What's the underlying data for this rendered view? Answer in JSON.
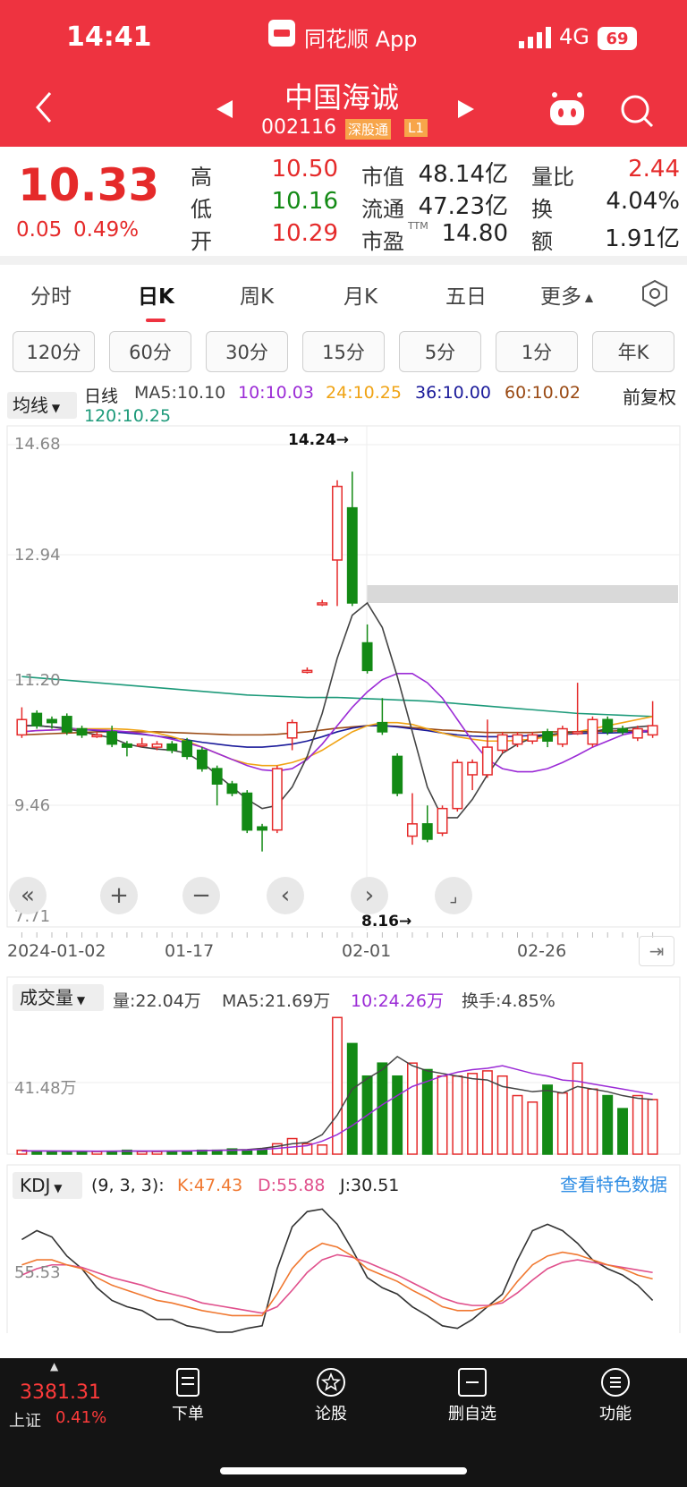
{
  "status": {
    "time": "14:41",
    "center_app": "同花顺 App",
    "signal": "4G",
    "battery": "69"
  },
  "stock": {
    "name": "中国海诚",
    "code": "002116",
    "tag1": "深股通",
    "tag2": "L1"
  },
  "quote": {
    "price": "10.33",
    "change": "0.05",
    "change_pct": "0.49%",
    "high_label": "高",
    "high": "10.50",
    "low_label": "低",
    "low": "10.16",
    "open_label": "开",
    "open": "10.29",
    "mcap_label": "市值",
    "mcap": "48.14亿",
    "float_label": "流通",
    "float": "47.23亿",
    "pe_label": "市盈",
    "pe_sup": "TTM",
    "pe": "14.80",
    "vr_label": "量比",
    "vr": "2.44",
    "turn_label": "换",
    "turn": "4.04%",
    "amt_label": "额",
    "amt": "1.91亿"
  },
  "tabs": [
    "分时",
    "日K",
    "周K",
    "月K",
    "五日",
    "更多"
  ],
  "periods": [
    "120分",
    "60分",
    "30分",
    "15分",
    "5分",
    "1分",
    "年K"
  ],
  "kline": {
    "ma_select": "均线",
    "kind": "日线",
    "ma5": "MA5:10.10",
    "ma10": "10:10.03",
    "ma24": "24:10.25",
    "ma36": "36:10.00",
    "ma60": "60:10.02",
    "ma120": "120:10.25",
    "adjust": "前复权",
    "ticks": [
      "14.68",
      "12.94",
      "11.20",
      "9.46",
      "7.71"
    ],
    "max_note": "14.24→",
    "min_note": "8.16→",
    "dates": [
      "2024-01-02",
      "01-17",
      "02-01",
      "02-26"
    ]
  },
  "volume": {
    "select": "成交量",
    "vol": "量:22.04万",
    "ma5": "MA5:21.69万",
    "ma10": "10:24.26万",
    "turnover": "换手:4.85%",
    "tick": "41.48万"
  },
  "kdj": {
    "select": "KDJ",
    "params": "(9, 3, 3):",
    "k": "K:47.43",
    "d": "D:55.88",
    "j": "J:30.51",
    "tick": "55.53",
    "feature_link": "查看特色数据"
  },
  "bottom": {
    "index_value": "3381.31",
    "index_name": "上证",
    "index_pct": "0.41%",
    "nav": [
      "下单",
      "论股",
      "删自选",
      "功能"
    ]
  },
  "chart_data": {
    "type": "candlestick",
    "title": "",
    "xlabel": "",
    "ylabel": "",
    "ylim": [
      7.71,
      14.68
    ],
    "bars": [
      {
        "o": 9.95,
        "c": 10.2,
        "h": 10.4,
        "l": 9.9
      },
      {
        "o": 10.3,
        "c": 10.1,
        "h": 10.35,
        "l": 10.05
      },
      {
        "o": 10.2,
        "c": 10.15,
        "h": 10.25,
        "l": 10.05
      },
      {
        "o": 10.25,
        "c": 10.0,
        "h": 10.3,
        "l": 9.95
      },
      {
        "o": 10.05,
        "c": 9.95,
        "h": 10.1,
        "l": 9.9
      },
      {
        "o": 9.95,
        "c": 9.95,
        "h": 10.0,
        "l": 9.9
      },
      {
        "o": 10.0,
        "c": 9.8,
        "h": 10.1,
        "l": 9.75
      },
      {
        "o": 9.8,
        "c": 9.75,
        "h": 9.85,
        "l": 9.6
      },
      {
        "o": 9.8,
        "c": 9.8,
        "h": 9.9,
        "l": 9.75
      },
      {
        "o": 9.75,
        "c": 9.8,
        "h": 9.85,
        "l": 9.7
      },
      {
        "o": 9.8,
        "c": 9.7,
        "h": 9.85,
        "l": 9.65
      },
      {
        "o": 9.85,
        "c": 9.6,
        "h": 9.9,
        "l": 9.55
      },
      {
        "o": 9.7,
        "c": 9.4,
        "h": 9.75,
        "l": 9.35
      },
      {
        "o": 9.4,
        "c": 9.15,
        "h": 9.45,
        "l": 8.8
      },
      {
        "o": 9.15,
        "c": 9.0,
        "h": 9.2,
        "l": 8.95
      },
      {
        "o": 9.0,
        "c": 8.4,
        "h": 9.05,
        "l": 8.35
      },
      {
        "o": 8.45,
        "c": 8.4,
        "h": 8.5,
        "l": 8.05
      },
      {
        "o": 8.4,
        "c": 9.4,
        "h": 9.45,
        "l": 8.35
      },
      {
        "o": 9.9,
        "c": 10.15,
        "h": 10.2,
        "l": 9.7
      },
      {
        "o": 11.0,
        "c": 11.0,
        "h": 11.05,
        "l": 10.95
      },
      {
        "o": 12.1,
        "c": 12.1,
        "h": 12.15,
        "l": 12.05
      },
      {
        "o": 12.8,
        "c": 14.0,
        "h": 14.1,
        "l": 12.05
      },
      {
        "o": 13.65,
        "c": 12.1,
        "h": 14.24,
        "l": 12.05
      },
      {
        "o": 11.45,
        "c": 11.0,
        "h": 11.75,
        "l": 10.95
      },
      {
        "o": 10.15,
        "c": 10.0,
        "h": 10.55,
        "l": 9.95
      },
      {
        "o": 9.6,
        "c": 9.0,
        "h": 9.65,
        "l": 8.95
      },
      {
        "o": 8.3,
        "c": 8.5,
        "h": 9.0,
        "l": 8.16
      },
      {
        "o": 8.5,
        "c": 8.25,
        "h": 8.8,
        "l": 8.2
      },
      {
        "o": 8.35,
        "c": 8.75,
        "h": 8.8,
        "l": 8.3
      },
      {
        "o": 8.75,
        "c": 9.5,
        "h": 9.55,
        "l": 8.7
      },
      {
        "o": 9.3,
        "c": 9.5,
        "h": 9.55,
        "l": 9.05
      },
      {
        "o": 9.3,
        "c": 9.75,
        "h": 10.2,
        "l": 9.25
      },
      {
        "o": 9.7,
        "c": 9.95,
        "h": 10.0,
        "l": 9.65
      },
      {
        "o": 9.8,
        "c": 9.95,
        "h": 10.0,
        "l": 9.75
      },
      {
        "o": 9.85,
        "c": 9.95,
        "h": 10.0,
        "l": 9.8
      },
      {
        "o": 10.0,
        "c": 9.85,
        "h": 10.05,
        "l": 9.75
      },
      {
        "o": 9.8,
        "c": 10.05,
        "h": 10.1,
        "l": 9.75
      },
      {
        "o": 10.0,
        "c": 10.0,
        "h": 10.8,
        "l": 9.95
      },
      {
        "o": 9.8,
        "c": 10.2,
        "h": 10.25,
        "l": 9.75
      },
      {
        "o": 10.2,
        "c": 10.0,
        "h": 10.25,
        "l": 9.95
      },
      {
        "o": 10.05,
        "c": 10.0,
        "h": 10.1,
        "l": 9.95
      },
      {
        "o": 9.9,
        "c": 10.05,
        "h": 10.1,
        "l": 9.85
      },
      {
        "o": 9.95,
        "c": 10.1,
        "h": 10.5,
        "l": 9.9
      }
    ],
    "ma5": [
      10.1,
      10.1,
      10.08,
      10.05,
      10.0,
      9.95,
      9.9,
      9.8,
      9.75,
      9.72,
      9.7,
      9.65,
      9.5,
      9.3,
      9.1,
      8.9,
      8.75,
      8.8,
      9.1,
      9.6,
      10.3,
      11.2,
      11.9,
      12.1,
      11.7,
      10.9,
      10.0,
      9.1,
      8.6,
      8.6,
      8.9,
      9.3,
      9.65,
      9.8,
      9.9,
      9.95,
      9.98,
      10.0,
      10.0,
      10.05,
      10.05,
      10.08,
      10.1
    ],
    "ma10": [
      10.0,
      10.02,
      10.03,
      10.04,
      10.04,
      10.03,
      10.02,
      10.0,
      9.97,
      9.93,
      9.88,
      9.82,
      9.75,
      9.65,
      9.55,
      9.45,
      9.38,
      9.36,
      9.4,
      9.55,
      9.8,
      10.1,
      10.4,
      10.65,
      10.85,
      10.95,
      10.95,
      10.8,
      10.55,
      10.2,
      9.85,
      9.55,
      9.4,
      9.35,
      9.35,
      9.4,
      9.5,
      9.62,
      9.75,
      9.85,
      9.95,
      10.0,
      10.03
    ],
    "ma24": [
      10.0,
      10.02,
      10.03,
      10.04,
      10.05,
      10.05,
      10.05,
      10.04,
      10.02,
      9.98,
      9.92,
      9.85,
      9.75,
      9.65,
      9.55,
      9.48,
      9.45,
      9.45,
      9.5,
      9.58,
      9.7,
      9.85,
      10.0,
      10.1,
      10.15,
      10.15,
      10.12,
      10.05,
      9.98,
      9.92,
      9.88,
      9.85,
      9.85,
      9.86,
      9.88,
      9.92,
      9.96,
      10.0,
      10.05,
      10.1,
      10.15,
      10.2,
      10.25
    ],
    "ma36": [
      10.1,
      10.1,
      10.08,
      10.06,
      10.04,
      10.02,
      10.0,
      9.98,
      9.96,
      9.93,
      9.9,
      9.87,
      9.83,
      9.8,
      9.77,
      9.75,
      9.75,
      9.77,
      9.8,
      9.85,
      9.92,
      10.0,
      10.06,
      10.1,
      10.1,
      10.08,
      10.05,
      10.02,
      9.98,
      9.95,
      9.93,
      9.92,
      9.92,
      9.93,
      9.94,
      9.95,
      9.96,
      9.97,
      9.98,
      9.98,
      9.99,
      10.0,
      10.0
    ],
    "ma60": [
      9.95,
      9.96,
      9.97,
      9.98,
      9.99,
      10.0,
      10.0,
      10.0,
      10.0,
      10.0,
      9.99,
      9.98,
      9.97,
      9.96,
      9.95,
      9.95,
      9.95,
      9.96,
      9.98,
      10.0,
      10.03,
      10.06,
      10.08,
      10.1,
      10.1,
      10.09,
      10.07,
      10.05,
      10.03,
      10.02,
      10.0,
      9.99,
      9.99,
      9.99,
      9.99,
      10.0,
      10.0,
      10.0,
      10.01,
      10.01,
      10.02,
      10.02,
      10.02
    ],
    "ma120": [
      10.9,
      10.88,
      10.86,
      10.84,
      10.82,
      10.8,
      10.78,
      10.76,
      10.74,
      10.72,
      10.7,
      10.68,
      10.66,
      10.64,
      10.62,
      10.6,
      10.59,
      10.58,
      10.57,
      10.56,
      10.56,
      10.56,
      10.55,
      10.54,
      10.53,
      10.52,
      10.51,
      10.5,
      10.48,
      10.46,
      10.44,
      10.42,
      10.4,
      10.38,
      10.36,
      10.34,
      10.32,
      10.3,
      10.29,
      10.28,
      10.27,
      10.26,
      10.25
    ],
    "volume": [
      3,
      2,
      2,
      2,
      2,
      2,
      2,
      3,
      2,
      2,
      2,
      2,
      3,
      3,
      4,
      3,
      4,
      8,
      12,
      8,
      7,
      105,
      85,
      60,
      70,
      60,
      70,
      65,
      60,
      60,
      62,
      64,
      60,
      45,
      40,
      53,
      47,
      70,
      50,
      45,
      35,
      45,
      42
    ],
    "vol_ma5": [
      2.5,
      2.5,
      2.4,
      2.3,
      2.2,
      2.2,
      2.3,
      2.4,
      2.3,
      2.3,
      2.4,
      2.5,
      2.8,
      3.0,
      3.3,
      3.5,
      4.5,
      6.0,
      8.0,
      9.0,
      15,
      30,
      50,
      58,
      65,
      75,
      68,
      64,
      62,
      60,
      58,
      57,
      52,
      50,
      48,
      49,
      47,
      52,
      50,
      48,
      45,
      43,
      42
    ],
    "vol_ma10": [
      2.5,
      2.5,
      2.4,
      2.4,
      2.4,
      2.3,
      2.3,
      2.4,
      2.4,
      2.4,
      2.4,
      2.5,
      2.7,
      2.9,
      3.0,
      3.2,
      3.6,
      4.5,
      5.5,
      6.5,
      10,
      15,
      22,
      30,
      38,
      45,
      52,
      56,
      60,
      63,
      65,
      66,
      68,
      65,
      62,
      60,
      57,
      56,
      54,
      52,
      50,
      48,
      46
    ],
    "kdj_k": [
      58,
      62,
      62,
      58,
      55,
      48,
      42,
      38,
      34,
      30,
      28,
      25,
      22,
      20,
      18,
      18,
      18,
      35,
      55,
      68,
      75,
      72,
      65,
      55,
      50,
      45,
      38,
      32,
      25,
      22,
      22,
      25,
      30,
      45,
      58,
      65,
      68,
      66,
      62,
      58,
      55,
      50,
      47
    ],
    "kdj_d": [
      50,
      55,
      58,
      58,
      56,
      52,
      48,
      45,
      42,
      38,
      35,
      32,
      28,
      26,
      24,
      22,
      20,
      25,
      38,
      52,
      62,
      66,
      64,
      60,
      55,
      50,
      44,
      38,
      32,
      28,
      26,
      26,
      28,
      36,
      46,
      55,
      60,
      62,
      60,
      58,
      56,
      54,
      52
    ],
    "kdj_j": [
      78,
      85,
      80,
      65,
      55,
      40,
      30,
      25,
      22,
      15,
      15,
      10,
      8,
      5,
      5,
      8,
      10,
      55,
      88,
      100,
      102,
      90,
      70,
      48,
      40,
      35,
      25,
      18,
      10,
      8,
      15,
      25,
      35,
      62,
      85,
      90,
      85,
      75,
      62,
      55,
      50,
      42,
      30
    ]
  }
}
